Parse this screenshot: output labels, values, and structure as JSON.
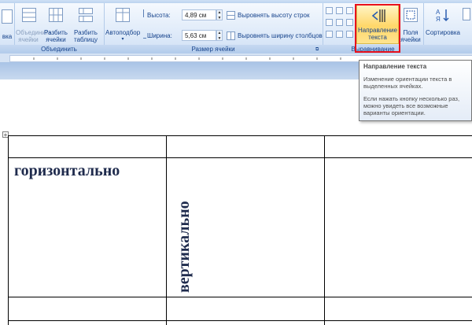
{
  "ribbon": {
    "merge_group": {
      "label": "Объединить",
      "merge_cells": "Объединить ячейки",
      "split_cells": "Разбить ячейки",
      "split_table": "Разбить таблицу"
    },
    "cell_size_group": {
      "label": "Размер ячейки",
      "autofit": "Автоподбор",
      "height_label": "Высота:",
      "height_value": "4,89 см",
      "width_label": "Ширина:",
      "width_value": "5,63 см",
      "distribute_rows": "Выровнять высоту строк",
      "distribute_cols": "Выровнять ширину столбцов"
    },
    "alignment_group": {
      "label": "Выравнивание",
      "text_direction": "Направление текста",
      "cell_margins": "Поля ячейки"
    },
    "data_group": {
      "sort": "Сортировка"
    },
    "left_partial": "вка"
  },
  "tooltip": {
    "title": "Направление текста",
    "desc1": "Изменение ориентации текста в выделенных ячейках.",
    "desc2": "Если нажать кнопку несколько раз, можно увидеть все возможные варианты ориентации."
  },
  "document": {
    "cell_horizontal": "горизонтально",
    "cell_vertical": "вертикально"
  },
  "colors": {
    "highlight": "#e8111d",
    "ribbon_text": "#15428b"
  }
}
